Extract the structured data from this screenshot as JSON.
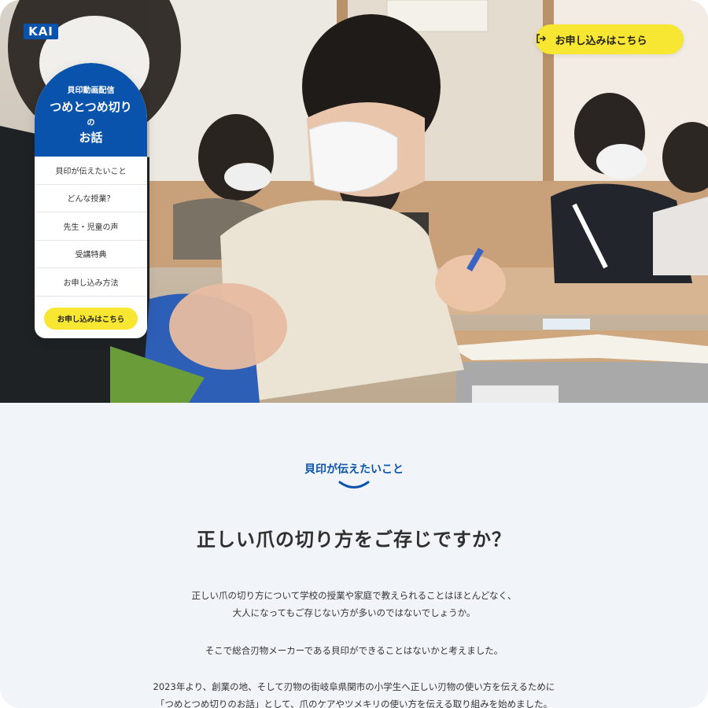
{
  "brand": {
    "logo_text": "KAI",
    "color": "#0a53ad"
  },
  "header": {
    "cta_label": "お申し込みはこちら",
    "cta_icon": "exit-arrow-icon",
    "cta_color": "#f7e632"
  },
  "sidenav": {
    "subtitle": "貝印動画配信",
    "title_line1": "つめとつめ切り",
    "title_connector": "の",
    "title_line2": "お話",
    "items": [
      {
        "label": "貝印が伝えたいこと"
      },
      {
        "label": "どんな授業？"
      },
      {
        "label": "先生・児童の声"
      },
      {
        "label": "受講特典"
      },
      {
        "label": "お申し込み方法"
      }
    ],
    "cta_label": "お申し込みはこちら"
  },
  "hero": {
    "image": "classroom-photo-children-wearing-masks"
  },
  "main": {
    "section_label": "貝印が伝えたいこと",
    "heading": "正しい爪の切り方をご存じですか？",
    "paragraph1_line1": "正しい爪の切り方について学校の授業や家庭で教えられることはほとんどなく、",
    "paragraph1_line2": "大人になってもご存じない方が多いのではないでしょうか。",
    "paragraph2": "そこで総合刃物メーカーである貝印ができることはないかと考えました。",
    "paragraph3_line1": "2023年より、創業の地、そして刃物の街岐阜県関市の小学生へ正しい刃物の使い方を伝えるために",
    "paragraph3_line2": "「つめとつめ切りのお話」として、爪のケアやツメキリの使い方を伝える取り組みを始めました。"
  }
}
